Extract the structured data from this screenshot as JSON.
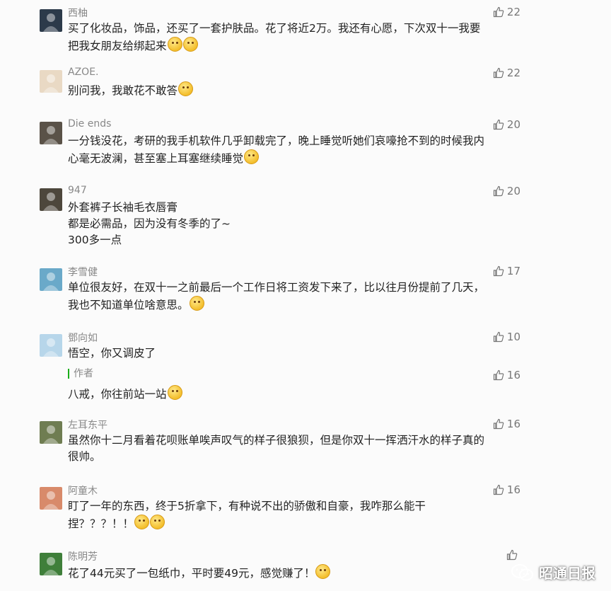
{
  "comments": [
    {
      "name": "西柚",
      "likes": "22",
      "text": "买了化妆品，饰品，还买了一套护肤品。花了将近2万。我还有心愿，下次双十一我要\n把我女朋友给绑起来",
      "emojis": 2,
      "avatar_color": "#2c3a4a"
    },
    {
      "name": "AZOE.",
      "likes": "22",
      "text": "别问我，我敢花不敢答",
      "emojis": 1,
      "avatar_color": "#e9d9c4"
    },
    {
      "name": "Die ends",
      "likes": "20",
      "text": "一分钱没花，考研的我手机软件几乎卸载完了，晚上睡觉听她们哀嚎抢不到的时候我内\n心毫无波澜，甚至塞上耳塞继续睡觉",
      "emojis": 1,
      "avatar_color": "#5a5248"
    },
    {
      "name": "947",
      "likes": "20",
      "text": "外套裤子长袖毛衣唇膏\n都是必需品，因为没有冬季的了~\n300多一点",
      "emojis": 0,
      "avatar_color": "#4d473c"
    },
    {
      "name": "李雪健",
      "likes": "17",
      "text": "单位很友好，在双十一之前最后一个工作日将工资发下来了，比以往月份提前了几天，\n我也不知道单位啥意思。",
      "emojis": 1,
      "avatar_color": "#6aa9c9"
    },
    {
      "name": "鄧向如",
      "likes": "10",
      "text": "悟空，你又调皮了",
      "emojis": 0,
      "avatar_color": "#b7d6ea",
      "reply": {
        "name": "作者",
        "likes": "16",
        "text": "八戒，你往前站一站",
        "emojis": 1
      }
    },
    {
      "name": "左耳东平",
      "likes": "16",
      "text": "虽然你十二月看着花呗账单唉声叹气的样子很狼狈，但是你双十一挥洒汗水的样子真的\n很帅。",
      "emojis": 0,
      "avatar_color": "#6f7d52"
    },
    {
      "name": "阿童木",
      "likes": "16",
      "text": "盯了一年的东西，终于5折拿下，有种说不出的骄傲和自豪，我咋那么能干\n捏？？？！！",
      "emojis": 2,
      "avatar_color": "#d88a6a"
    },
    {
      "name": "陈明芳",
      "likes": "",
      "text": "花了44元买了一包纸巾，平时要49元，感觉赚了！",
      "emojis": 1,
      "avatar_color": "#3f7f3a"
    }
  ],
  "watermark": {
    "text": "昭通日报"
  }
}
